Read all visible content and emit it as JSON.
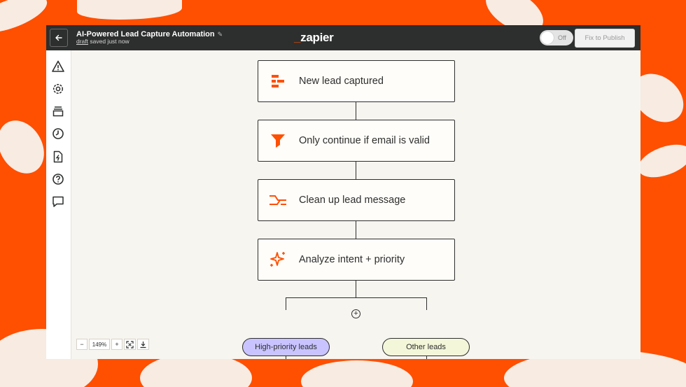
{
  "header": {
    "title": "AI-Powered Lead Capture Automation",
    "status_link": "draft",
    "status_text": "saved just now",
    "logo_prefix": "_",
    "logo_text": "zapier",
    "toggle_label": "Off",
    "publish_label": "Fix to Publish"
  },
  "sidebar": {
    "items": [
      {
        "icon": "warning-icon"
      },
      {
        "icon": "settings-icon"
      },
      {
        "icon": "versions-icon"
      },
      {
        "icon": "history-icon"
      },
      {
        "icon": "file-zap-icon"
      },
      {
        "icon": "help-icon"
      },
      {
        "icon": "comment-icon"
      }
    ]
  },
  "steps": [
    {
      "label": "New lead captured",
      "icon": "form-icon"
    },
    {
      "label": "Only continue if email is valid",
      "icon": "filter-icon"
    },
    {
      "label": "Clean up lead message",
      "icon": "formatter-icon"
    },
    {
      "label": "Analyze intent + priority",
      "icon": "ai-sparkle-icon"
    }
  ],
  "branches": [
    {
      "label": "High-priority leads",
      "color": "#c9c4ff"
    },
    {
      "label": "Other leads",
      "color": "#f4f6d9"
    }
  ],
  "zoom": {
    "minus": "−",
    "level": "149%",
    "plus": "+"
  },
  "colors": {
    "accent": "#ff4f00",
    "topbar": "#2d2e2e",
    "canvas": "#f7f5f0"
  }
}
